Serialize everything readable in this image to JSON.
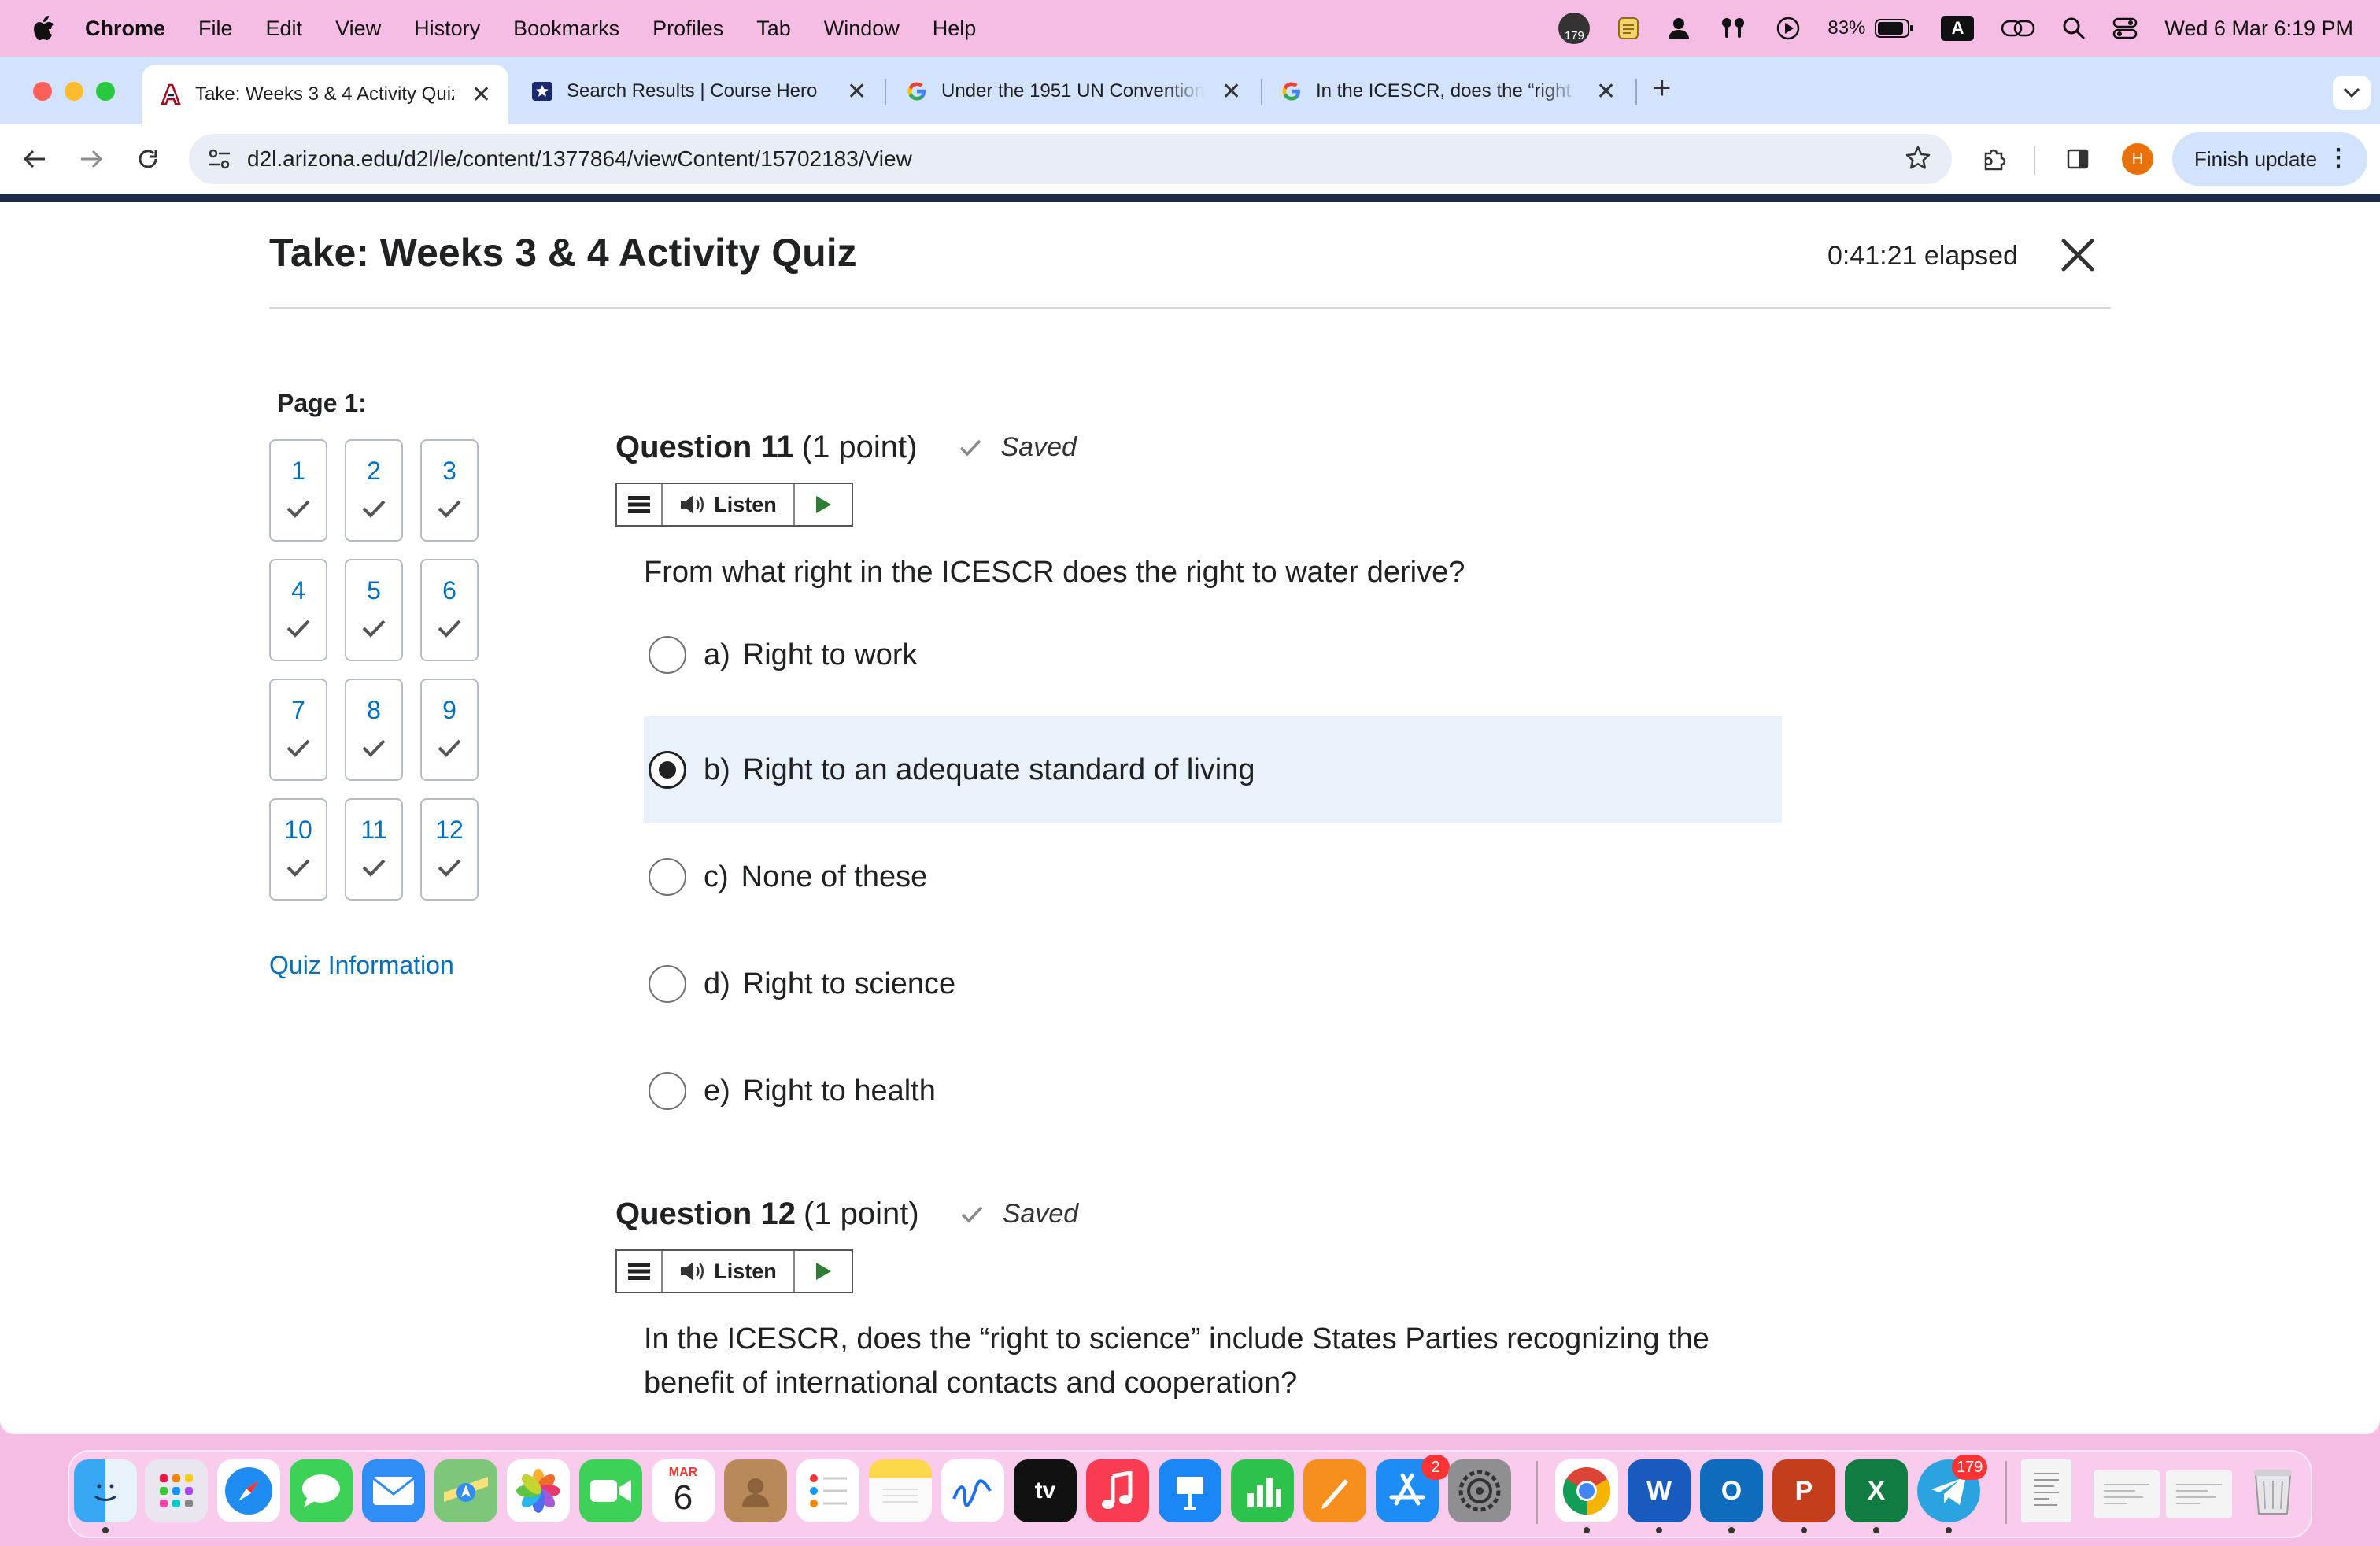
{
  "menubar": {
    "app_name": "Chrome",
    "items": [
      "File",
      "Edit",
      "View",
      "History",
      "Bookmarks",
      "Profiles",
      "Tab",
      "Window",
      "Help"
    ],
    "status": {
      "badge_count": "179",
      "input_source": "A",
      "battery_percent": "83%",
      "datetime": "Wed 6 Mar  6:19 PM"
    }
  },
  "browser": {
    "tabs": [
      {
        "title": "Take: Weeks 3 & 4 Activity Quiz",
        "icon": "university-a-icon",
        "active": true
      },
      {
        "title": "Search Results | Course Hero",
        "icon": "star-shield-icon",
        "active": false
      },
      {
        "title": "Under the 1951 UN Convention",
        "icon": "google-g-icon",
        "active": false
      },
      {
        "title": "In the ICESCR, does the “right",
        "icon": "google-g-icon",
        "active": false
      }
    ],
    "url": "d2l.arizona.edu/d2l/le/content/1377864/viewContent/15702183/View",
    "profile_initial": "H",
    "finish_update_label": "Finish update",
    "colors": {
      "tabstrip": "#d3e3fd",
      "omnibox": "#e9eef6",
      "accent_rule": "#1d2b49"
    }
  },
  "quiz": {
    "title": "Take: Weeks 3 & 4 Activity Quiz",
    "elapsed": "0:41:21 elapsed",
    "page_label": "Page 1:",
    "nav_numbers": [
      "1",
      "2",
      "3",
      "4",
      "5",
      "6",
      "7",
      "8",
      "9",
      "10",
      "11",
      "12"
    ],
    "quiz_info_label": "Quiz Information",
    "listen_label": "Listen",
    "saved_label": "Saved",
    "link_color": "#006fbf",
    "selected_bg": "#e9f1fb",
    "questions": [
      {
        "title": "Question 11",
        "points": "(1 point)",
        "text": "From what right in the ICESCR does the right to water derive?",
        "options": [
          {
            "letter": "a)",
            "label": "Right to work",
            "selected": false
          },
          {
            "letter": "b)",
            "label": "Right to an adequate standard of living",
            "selected": true
          },
          {
            "letter": "c)",
            "label": "None of these",
            "selected": false
          },
          {
            "letter": "d)",
            "label": "Right to science",
            "selected": false
          },
          {
            "letter": "e)",
            "label": "Right to health",
            "selected": false
          }
        ]
      },
      {
        "title": "Question 12",
        "points": "(1 point)",
        "text": "In the ICESCR, does the “right to science” include States Parties recognizing the benefit of international contacts and cooperation?"
      }
    ]
  },
  "dock": {
    "calendar_month": "MAR",
    "calendar_day": "6",
    "tv_label": "tv",
    "appstore_badge": "2",
    "telegram_badge": "179",
    "word_letter": "W",
    "outlook_letter": "O",
    "powerpoint_letter": "P",
    "excel_letter": "X"
  }
}
